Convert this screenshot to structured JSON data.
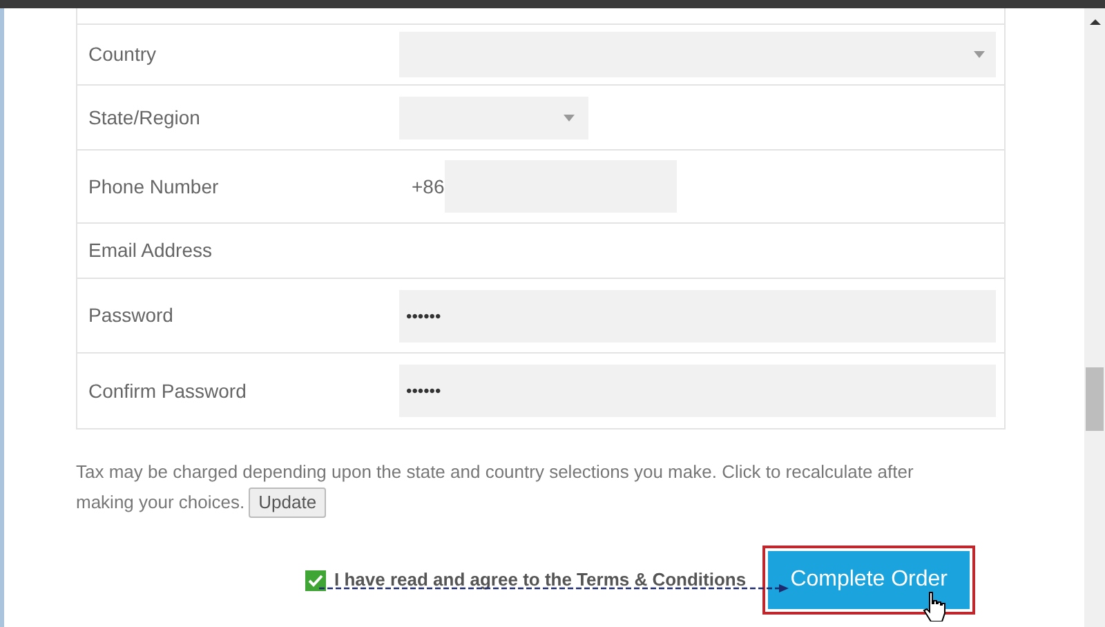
{
  "form_rows": [
    {
      "label": "Country",
      "kind": "select"
    },
    {
      "label": "State/Region",
      "kind": "select_small"
    },
    {
      "label": "Phone Number",
      "kind": "phone",
      "prefix": "+86"
    },
    {
      "label": "Email Address",
      "kind": "none"
    },
    {
      "label": "Password",
      "kind": "password",
      "value": "••••••"
    },
    {
      "label": "Confirm Password",
      "kind": "password",
      "value": "••••••"
    }
  ],
  "tax_note": [
    "Tax may be charged depending upon the state and country selections you make. Click to recalculate after",
    "making your choices."
  ],
  "update_button": "Update",
  "terms": {
    "label": "I have read and agree to the Terms & Conditions",
    "checked": true
  },
  "complete_button": "Complete Order"
}
